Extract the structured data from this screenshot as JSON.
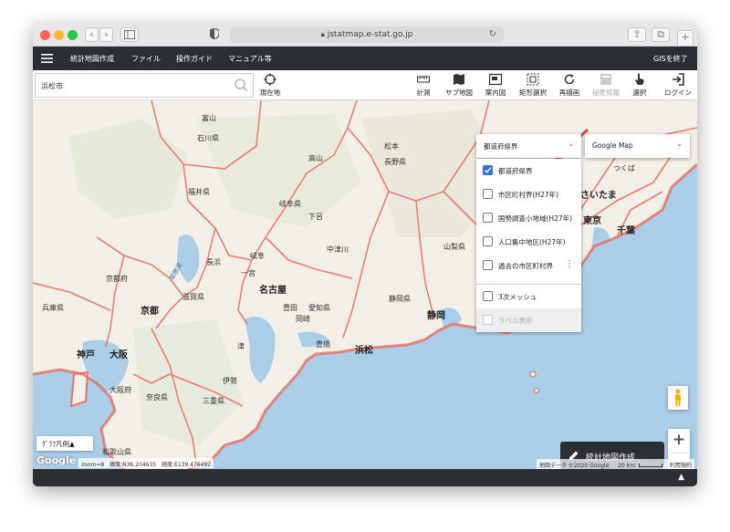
{
  "browser": {
    "url": "jstatmap.e-stat.go.jp"
  },
  "nav": {
    "items": [
      "統計地図作成",
      "ファイル",
      "操作ガイド",
      "マニュアル等"
    ],
    "exit_label": "GISを終了"
  },
  "toolbar": {
    "search_value": "浜松市",
    "current_location": "現在地",
    "tools": [
      {
        "label": "計測",
        "icon": "ruler-icon",
        "enabled": true
      },
      {
        "label": "サブ地図",
        "icon": "map-icon",
        "enabled": true
      },
      {
        "label": "案内図",
        "icon": "overview-map-icon",
        "enabled": true
      },
      {
        "label": "矩形選択",
        "icon": "rect-select-icon",
        "enabled": true
      },
      {
        "label": "再描画",
        "icon": "refresh-icon",
        "enabled": true
      },
      {
        "label": "秘匿情報",
        "icon": "secret-info-icon",
        "enabled": false
      },
      {
        "label": "選択",
        "icon": "pointer-icon",
        "enabled": true
      },
      {
        "label": "ログイン",
        "icon": "login-icon",
        "enabled": true
      }
    ]
  },
  "map": {
    "labels": {
      "ishikawa": "石川県",
      "toyama": "富山",
      "fukui": "福井県",
      "gifu": "岐阜県",
      "nagano": "長野県",
      "takayama": "高山",
      "matsumoto": "松本",
      "gero": "下呂",
      "nakatsugawa": "中津川",
      "yamanashi": "山梨県",
      "nagoya": "名古屋",
      "aichi": "愛知県",
      "toyota": "豊田",
      "okazaki": "岡崎",
      "toyohashi": "豊橋",
      "hamamatsu": "浜松",
      "shizuoka_city": "静岡",
      "shizuoka": "静岡県",
      "kyoto_pref": "京都府",
      "kyoto": "京都",
      "nagahama": "長浜",
      "biwako": "琵琶湖",
      "shiga": "滋賀県",
      "hyogo": "兵庫県",
      "kobe": "神戸",
      "osaka": "大阪",
      "osaka_pref": "大阪府",
      "nara": "奈良県",
      "mie": "三重県",
      "ise": "伊勢",
      "wakayama": "和歌山県",
      "tokyo": "東京",
      "chiba": "千葉",
      "tsukuba": "つくば",
      "saitama": "さいたま",
      "ichinomiya": "一宮",
      "gifu_city": "岐阜",
      "tsu": "津"
    },
    "layer_select_value": "都道府県界",
    "basemap_select_value": "Google Map",
    "layers": [
      {
        "label": "都道府県界",
        "checked": true
      },
      {
        "label": "市区町村界(H27年)",
        "checked": false
      },
      {
        "label": "国勢調査小地域(H27年)",
        "checked": false
      },
      {
        "label": "人口集中地区(H27年)",
        "checked": false
      },
      {
        "label": "過去の市区町村界",
        "checked": false
      }
    ],
    "mesh_label": "3次メッシュ",
    "label_display": "ラベル表示",
    "legend_button": "ｸﾞﾗﾌ凡例▲",
    "create_map_button": "統計地図作成",
    "zoom_in": "+",
    "zoom_out": "−",
    "status": {
      "zoom": "zoom=8",
      "lat": "緯度:N36.204635",
      "lon": "経度:E139.476492"
    },
    "attribution": "地図データ ©2020 Google",
    "scale": "20 km",
    "terms": "利用規約",
    "google_logo": "Google"
  },
  "colors": {
    "boundary": "#e8736b",
    "water": "#aacde8",
    "land": "#f1efe7",
    "navbar": "#2b2f33",
    "checkbox_checked": "#2f6fe0",
    "arrow": "#e8432b"
  }
}
